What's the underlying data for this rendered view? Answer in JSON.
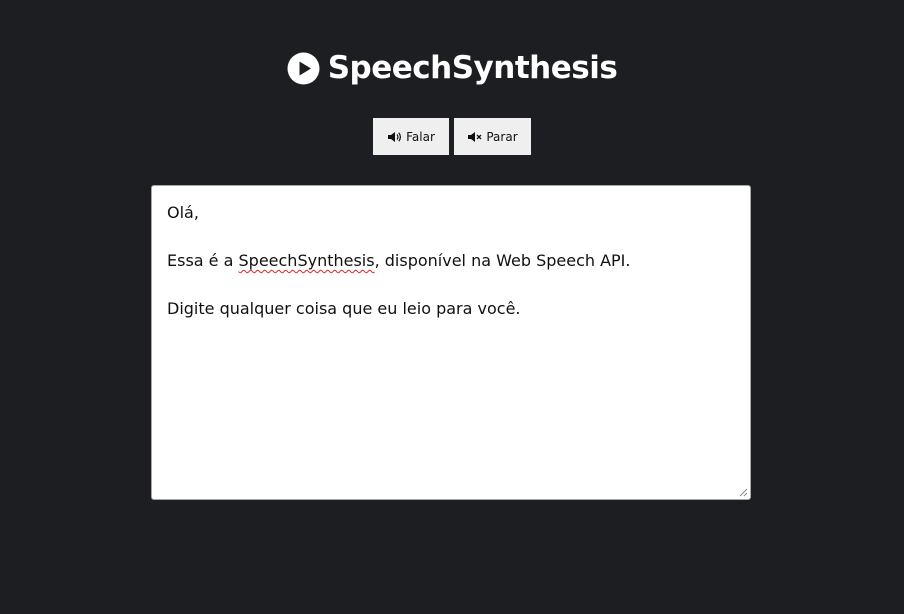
{
  "header": {
    "logo_icon": "play-circle-icon",
    "title": "SpeechSynthesis"
  },
  "controls": {
    "speak": {
      "label": "Falar",
      "icon": "volume-up-icon"
    },
    "stop": {
      "label": "Parar",
      "icon": "volume-mute-icon"
    }
  },
  "editor": {
    "line_1": "Olá,",
    "line_2_before": "Essa é a ",
    "line_2_flagged_word": "SpeechSynthesis",
    "line_2_after": ", disponível na Web Speech API.",
    "line_3": "Digite qualquer coisa que eu leio para você."
  },
  "colors": {
    "background": "#1d1e22",
    "button": "#efefef",
    "spellcheck_underline": "#dd2222"
  }
}
